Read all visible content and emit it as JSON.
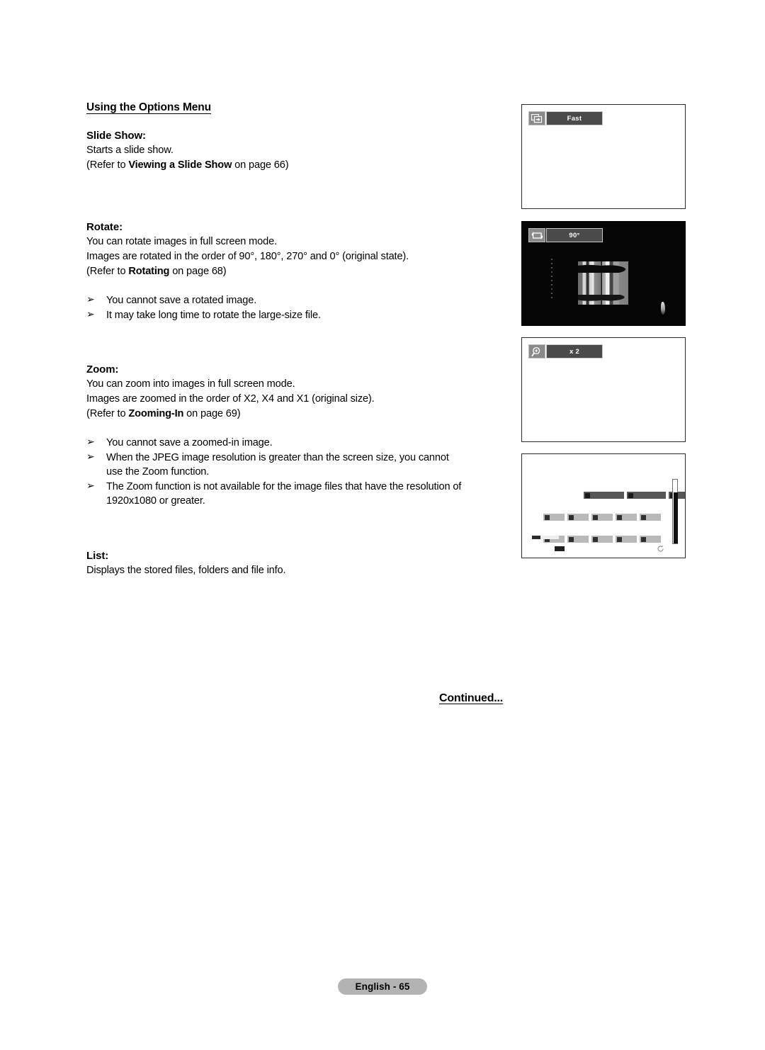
{
  "page": {
    "title": "Using the Options Menu",
    "footer_label": "English - 65",
    "continued_label": "Continued..."
  },
  "sections": [
    {
      "heading": "Slide Show:",
      "lines": [
        {
          "text": "Starts a slide show."
        },
        {
          "pre": "(Refer to ",
          "bold": "Viewing a Slide Show",
          "post": " on page 66)"
        }
      ],
      "bullets": []
    },
    {
      "heading": "Rotate:",
      "lines": [
        {
          "text": "You can rotate images in full screen mode."
        },
        {
          "text": "Images are rotated in the order of 90°, 180°, 270° and 0° (original state)."
        },
        {
          "pre": "(Refer to ",
          "bold": "Rotating",
          "post": " on page 68)"
        }
      ],
      "bullets": [
        {
          "glyph": "➢",
          "text": "You cannot save a rotated image.",
          "cont": ""
        },
        {
          "glyph": "➢",
          "text": "It may take long time to rotate the large-size file.",
          "cont": ""
        }
      ]
    },
    {
      "heading": "Zoom:",
      "lines": [
        {
          "text": "You can zoom into images in full screen mode."
        },
        {
          "text": "Images are zoomed in the order of X2, X4 and X1 (original size)."
        },
        {
          "pre": "(Refer to ",
          "bold": "Zooming-In",
          "post": " on page 69)"
        }
      ],
      "bullets": [
        {
          "glyph": "➢",
          "text": "You cannot save a zoomed-in image.",
          "cont": ""
        },
        {
          "glyph": "➢",
          "text": "When the JPEG image resolution is greater than the screen size, you cannot",
          "cont": "use the Zoom function."
        },
        {
          "glyph": "➢",
          "text": "The Zoom function is not available for the image files that have the resolution of",
          "cont": "1920x1080 or greater."
        }
      ]
    },
    {
      "heading": "List:",
      "lines": [
        {
          "text": "Displays the stored files, folders and file info."
        }
      ],
      "bullets": []
    }
  ],
  "figures": [
    {
      "id": "slideshow",
      "icon_name": "slide-show-icon",
      "badge_label": "Fast",
      "background": "#ffffff"
    },
    {
      "id": "rotate",
      "icon_name": "rotate-icon",
      "badge_label": "90°",
      "background": "#050505"
    },
    {
      "id": "zoom",
      "icon_name": "magnifier-plus-icon",
      "badge_label": "x 2",
      "background": "#ffffff"
    },
    {
      "id": "list",
      "icon_name": "file-list-icon",
      "badge_label": "",
      "background": "#ffffff"
    }
  ],
  "colors": {
    "badge_icon_bg": "#8a8a8a",
    "badge_label_bg": "#4a4a4a",
    "badge_text": "#ffffff",
    "footer_pill_bg": "#b3b3b3",
    "figure_border": "#2b2b2b",
    "list_chip": "#b9b9b9",
    "list_chip_dark": "#575757"
  }
}
